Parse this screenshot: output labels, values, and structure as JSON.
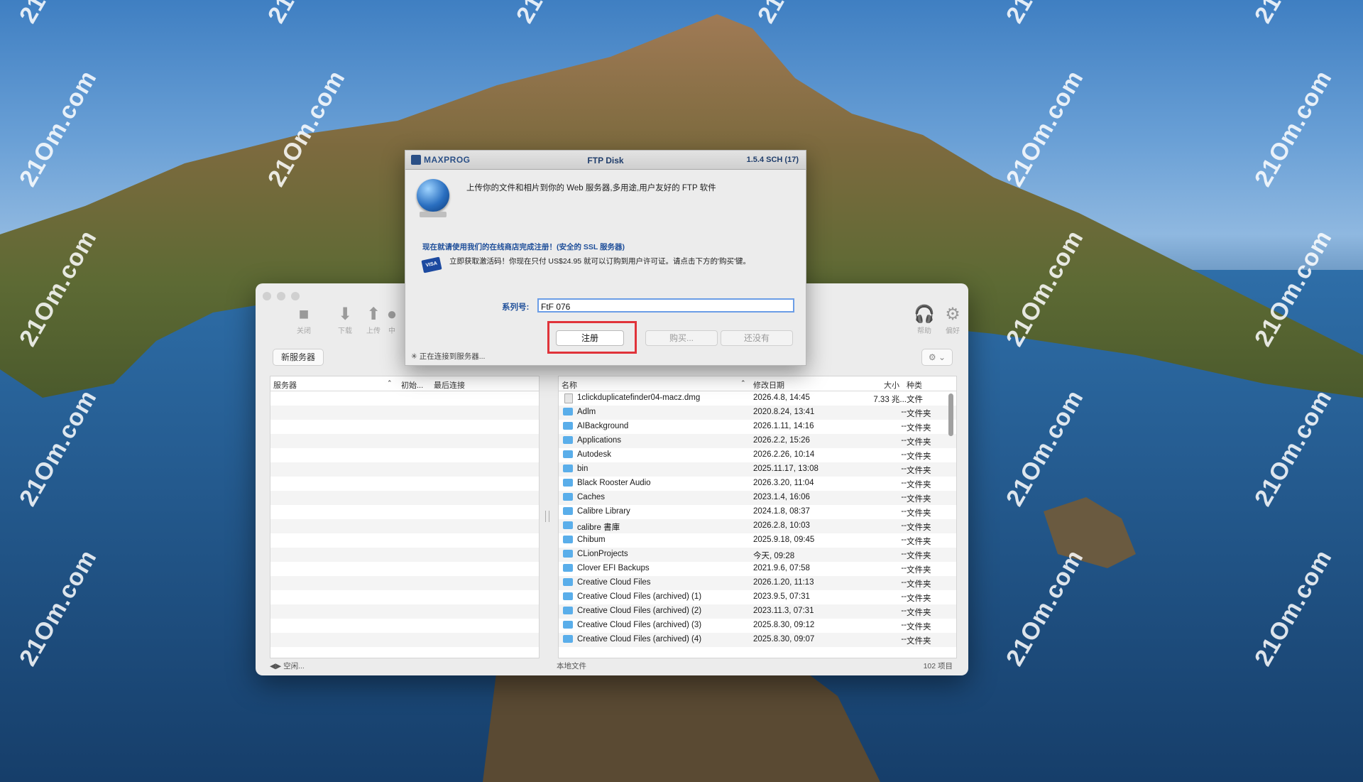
{
  "watermark": "21Om.com",
  "toolbar": {
    "close_label": "关闭",
    "download_label": "下载",
    "upload_label": "上传",
    "stop_label": "中",
    "help_label": "帮助",
    "prefs_label": "偏好"
  },
  "new_server_label": "新服务器",
  "server_list": {
    "columns": [
      "服务器",
      "初始...",
      "最后连接"
    ]
  },
  "file_list": {
    "columns": [
      "名称",
      "修改日期",
      "大小",
      "种类"
    ],
    "rows": [
      {
        "name": "1clickduplicatefinder04-macz.dmg",
        "date": "2026.4.8, 14:45",
        "size": "7.33 兆...",
        "kind": "文件",
        "icon": "document-icon"
      },
      {
        "name": "Adlm",
        "date": "2020.8.24, 13:41",
        "size": "--",
        "kind": "文件夹",
        "icon": "folder-icon"
      },
      {
        "name": "AIBackground",
        "date": "2026.1.11, 14:16",
        "size": "--",
        "kind": "文件夹",
        "icon": "folder-icon"
      },
      {
        "name": "Applications",
        "date": "2026.2.2, 15:26",
        "size": "--",
        "kind": "文件夹",
        "icon": "folder-icon"
      },
      {
        "name": "Autodesk",
        "date": "2026.2.26, 10:14",
        "size": "--",
        "kind": "文件夹",
        "icon": "folder-icon"
      },
      {
        "name": "bin",
        "date": "2025.11.17, 13:08",
        "size": "--",
        "kind": "文件夹",
        "icon": "folder-icon"
      },
      {
        "name": "Black Rooster Audio",
        "date": "2026.3.20, 11:04",
        "size": "--",
        "kind": "文件夹",
        "icon": "folder-icon"
      },
      {
        "name": "Caches",
        "date": "2023.1.4, 16:06",
        "size": "--",
        "kind": "文件夹",
        "icon": "folder-icon"
      },
      {
        "name": "Calibre Library",
        "date": "2024.1.8, 08:37",
        "size": "--",
        "kind": "文件夹",
        "icon": "folder-icon"
      },
      {
        "name": "calibre 書庫",
        "date": "2026.2.8, 10:03",
        "size": "--",
        "kind": "文件夹",
        "icon": "folder-icon"
      },
      {
        "name": "Chibum",
        "date": "2025.9.18, 09:45",
        "size": "--",
        "kind": "文件夹",
        "icon": "folder-icon"
      },
      {
        "name": "CLionProjects",
        "date": "今天, 09:28",
        "size": "--",
        "kind": "文件夹",
        "icon": "folder-icon"
      },
      {
        "name": "Clover EFI Backups",
        "date": "2021.9.6, 07:58",
        "size": "--",
        "kind": "文件夹",
        "icon": "folder-icon"
      },
      {
        "name": "Creative Cloud Files",
        "date": "2026.1.20, 11:13",
        "size": "--",
        "kind": "文件夹",
        "icon": "folder-icon"
      },
      {
        "name": "Creative Cloud Files (archived) (1)",
        "date": "2023.9.5, 07:31",
        "size": "--",
        "kind": "文件夹",
        "icon": "folder-icon"
      },
      {
        "name": "Creative Cloud Files (archived) (2)",
        "date": "2023.11.3, 07:31",
        "size": "--",
        "kind": "文件夹",
        "icon": "folder-icon"
      },
      {
        "name": "Creative Cloud Files (archived) (3)",
        "date": "2025.8.30, 09:12",
        "size": "--",
        "kind": "文件夹",
        "icon": "folder-icon"
      },
      {
        "name": "Creative Cloud Files (archived) (4)",
        "date": "2025.8.30, 09:07",
        "size": "--",
        "kind": "文件夹",
        "icon": "folder-icon"
      }
    ]
  },
  "status_left": "空闲...",
  "status_mid": "本地文件",
  "status_right": "102 项目",
  "dialog": {
    "logo": "MAXPROG",
    "title": "FTP Disk",
    "version": "1.5.4 SCH (17)",
    "tagline": "上传你的文件和相片到你的 Web 服务器,多用途,用户友好的 FTP 软件",
    "store_heading": "现在就请使用我们的在线商店完成注册！(安全的 SSL 服务器)",
    "store_text": "立即获取激活码！你现在只付 US$24.95 就可以订购到用户许可证。请点击下方的'购买'键。",
    "card_label": "VISA",
    "serial_label": "系列号:",
    "serial_value": "FtF                                   076",
    "register_label": "注册",
    "buy_label": "购买...",
    "later_label": "还没有",
    "status": "正在连接到服务器..."
  }
}
